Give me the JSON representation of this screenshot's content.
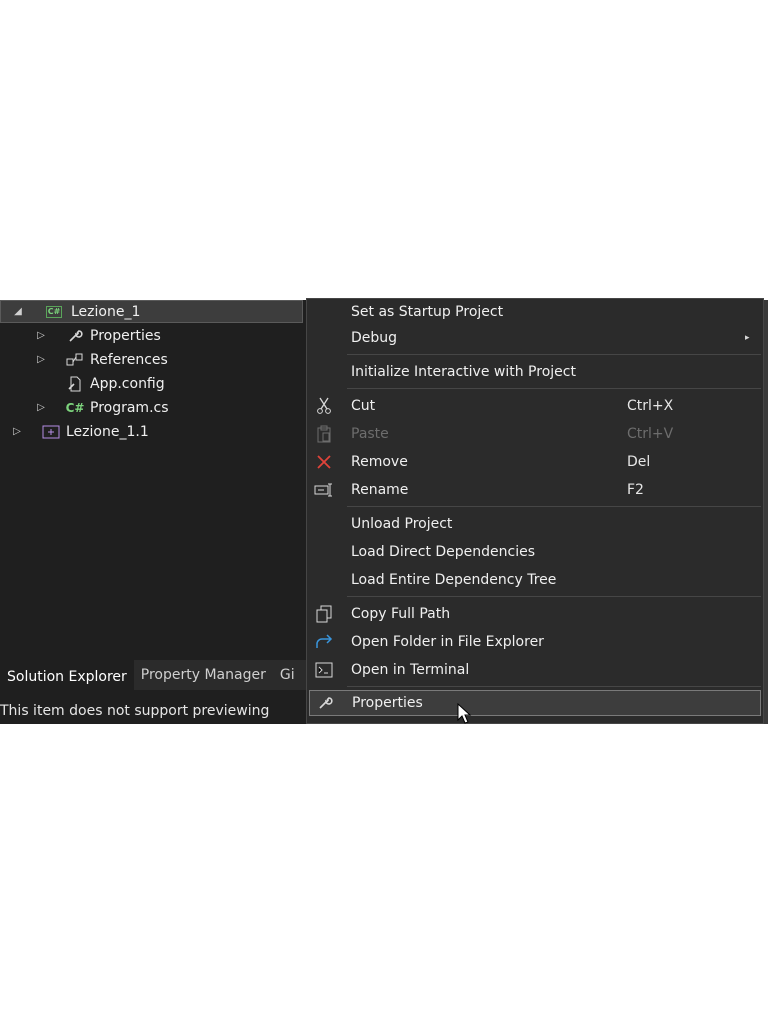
{
  "tree": {
    "items": [
      {
        "label": "Lezione_1",
        "twisty": "◢",
        "icon": "csharp-project-icon"
      },
      {
        "label": "Properties",
        "twisty": "▷",
        "icon": "wrench-icon"
      },
      {
        "label": "References",
        "twisty": "▷",
        "icon": "references-icon"
      },
      {
        "label": "App.config",
        "twisty": "",
        "icon": "config-file-icon"
      },
      {
        "label": "Program.cs",
        "twisty": "▷",
        "icon": "csharp-file-icon",
        "icon_text": "C#"
      },
      {
        "label": "Lezione_1.1",
        "twisty": "▷",
        "icon": "project-icon"
      }
    ],
    "project_badge": "C#"
  },
  "tabs": [
    "Solution Explorer",
    "Property Manager",
    "Gi"
  ],
  "preview_text": "This item does not support previewing",
  "menu": {
    "items": [
      {
        "label": "Set as Startup Project"
      },
      {
        "label": "Debug",
        "submenu": "▸"
      },
      {
        "label": "Initialize Interactive with Project"
      },
      {
        "label": "Cut",
        "shortcut": "Ctrl+X",
        "icon": "scissors-icon"
      },
      {
        "label": "Paste",
        "shortcut": "Ctrl+V",
        "icon": "clipboard-icon",
        "disabled": true
      },
      {
        "label": "Remove",
        "shortcut": "Del",
        "icon": "close-icon"
      },
      {
        "label": "Rename",
        "shortcut": "F2",
        "icon": "rename-icon"
      },
      {
        "label": "Unload Project"
      },
      {
        "label": "Load Direct Dependencies"
      },
      {
        "label": "Load Entire Dependency Tree"
      },
      {
        "label": "Copy Full Path",
        "icon": "copy-icon"
      },
      {
        "label": "Open Folder in File Explorer",
        "icon": "open-folder-icon"
      },
      {
        "label": "Open in Terminal",
        "icon": "terminal-icon"
      },
      {
        "label": "Properties",
        "icon": "wrench-icon",
        "hovered": true
      }
    ]
  },
  "colors": {
    "background": "#1f1f1f",
    "menu_bg": "#2b2b2b",
    "remove_icon": "#e0433a",
    "csharp_green": "#7cd37c",
    "folder_blue": "#3a96dd"
  }
}
